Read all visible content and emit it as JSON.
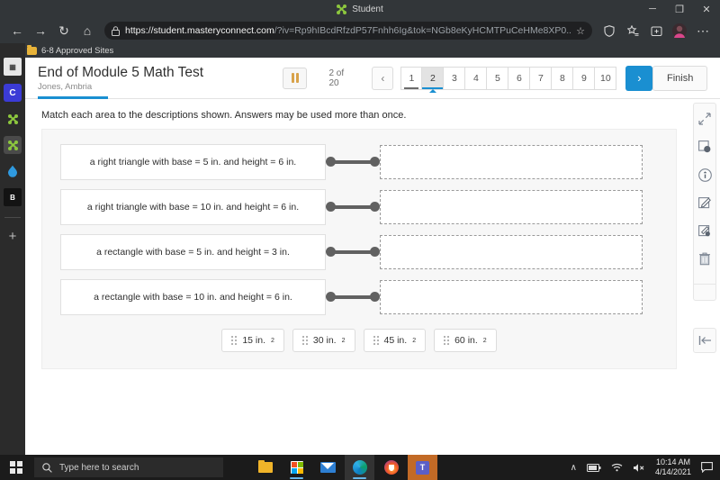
{
  "browser": {
    "tab_title": "Student",
    "window_minimize": "─",
    "window_restore": "❐",
    "window_close": "✕",
    "back_icon": "←",
    "forward_icon": "→",
    "reload_icon": "↻",
    "home_icon": "⌂",
    "lock_icon": "ὑ2",
    "url_host": "https://student.masteryconnect.com",
    "url_path": "/?iv=Rp9hIBcdRfzdP57Fnhh6Ig&tok=NGb8eKyHCMTPuCeHMe8XP0...",
    "omni_star_icon": "☆",
    "bookmark_label": "6-8 Approved Sites",
    "right_icons": [
      "shield-icon",
      "favorites-icon",
      "collections-icon",
      "profile-avatar",
      "settings-more-icon"
    ]
  },
  "left_rail": {
    "items": [
      {
        "name": "windows-app-icon",
        "label": "▦"
      },
      {
        "name": "canvas-app-icon",
        "label": "C"
      },
      {
        "name": "masteryconnect-icon",
        "label": ""
      },
      {
        "name": "masteryconnect-active-icon",
        "label": ""
      },
      {
        "name": "water-drop-icon",
        "label": "Ὂ7"
      },
      {
        "name": "bitmoji-icon",
        "label": "B"
      }
    ],
    "add_label": "+"
  },
  "assessment": {
    "title": "End of Module 5 Math Test",
    "student": "Jones, Ambria",
    "pause_label": "pause-icon",
    "counter": "2 of 20",
    "prev_label": "‹",
    "next_label": "›",
    "finish_label": "Finish",
    "pages": [
      {
        "num": "1",
        "state": "visited"
      },
      {
        "num": "2",
        "state": "current"
      },
      {
        "num": "3",
        "state": "normal"
      },
      {
        "num": "4",
        "state": "normal"
      },
      {
        "num": "5",
        "state": "normal"
      },
      {
        "num": "6",
        "state": "normal"
      },
      {
        "num": "7",
        "state": "normal"
      },
      {
        "num": "8",
        "state": "normal"
      },
      {
        "num": "9",
        "state": "normal"
      },
      {
        "num": "10",
        "state": "normal"
      }
    ]
  },
  "question": {
    "prompt": "Match each area to the descriptions shown. Answers may be used more than once.",
    "items": [
      {
        "text": "a right triangle with base = 5 in. and height = 6 in.",
        "answer": ""
      },
      {
        "text": "a right triangle with base = 10 in. and height = 6 in.",
        "answer": ""
      },
      {
        "text": "a rectangle with base = 5 in. and height = 3 in.",
        "answer": ""
      },
      {
        "text": "a rectangle with base = 10 in. and height = 6 in.",
        "answer": ""
      }
    ],
    "tokens": [
      {
        "value": "15 in.",
        "unit": "2"
      },
      {
        "value": "30 in.",
        "unit": "2"
      },
      {
        "value": "45 in.",
        "unit": "2"
      },
      {
        "value": "60 in.",
        "unit": "2"
      }
    ]
  },
  "tools": [
    {
      "name": "fullscreen-expand-icon"
    },
    {
      "name": "magnifier-tool-icon"
    },
    {
      "name": "info-circle-icon"
    },
    {
      "name": "notes-edit-icon"
    },
    {
      "name": "highlighter-icon"
    },
    {
      "name": "trash-icon"
    }
  ],
  "collapse_label": "⤒",
  "taskbar": {
    "search_placeholder": "Type here to search",
    "search_icon": "⌕",
    "apps": [
      "file-explorer-icon",
      "microsoft-store-icon",
      "mail-icon",
      "edge-icon",
      "firefox-icon",
      "teams-icon"
    ],
    "teams_letter": "T",
    "chevron_icon": "∧",
    "battery_icon": "▬",
    "wifi_icon": "◠",
    "volume_icon": "ὐ7",
    "time": "10:14 AM",
    "date": "4/14/2021",
    "notification_icon": "▭"
  },
  "colors": {
    "accent_blue": "#1a8fd1",
    "chrome_dark": "#323639",
    "taskbar": "#1b1b1b",
    "mc_green": "#8cc63e"
  }
}
